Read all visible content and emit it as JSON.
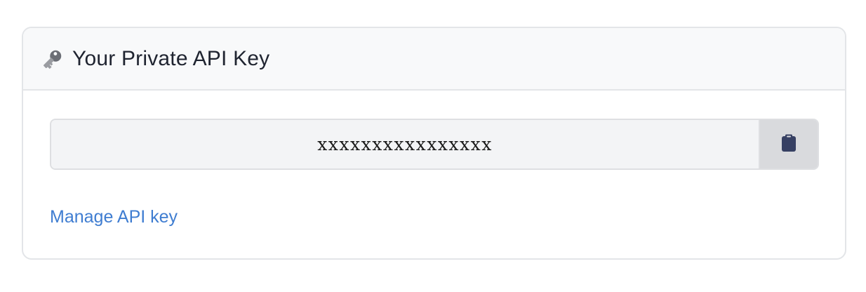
{
  "card": {
    "title": "Your Private API Key",
    "title_icon": "key-icon"
  },
  "api_key": {
    "value": "xxxxxxxxxxxxxxxx",
    "copy_icon": "clipboard-icon"
  },
  "manage_link": {
    "label": "Manage API key"
  },
  "colors": {
    "accent_link": "#3f7dd1",
    "header_bg": "#f8f9fa",
    "field_bg": "#f3f4f6",
    "copy_button_bg": "#d9dadd",
    "icon_dark": "#374063"
  }
}
